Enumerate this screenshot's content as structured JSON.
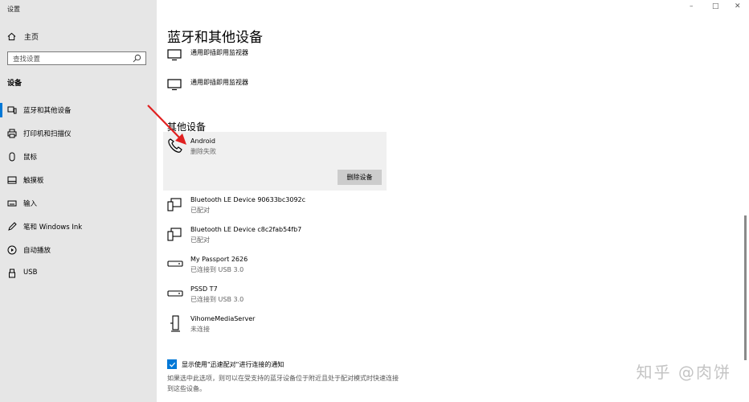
{
  "window": {
    "title": "设置",
    "minimize": "–",
    "maximize": "□",
    "close": "✕"
  },
  "sidebar": {
    "home_label": "主页",
    "search_placeholder": "查找设置",
    "section_title": "设备",
    "items": [
      {
        "label": "蓝牙和其他设备",
        "icon": "bluetooth-devices-icon",
        "active": true
      },
      {
        "label": "打印机和扫描仪",
        "icon": "printer-icon",
        "active": false
      },
      {
        "label": "鼠标",
        "icon": "mouse-icon",
        "active": false
      },
      {
        "label": "触摸板",
        "icon": "touchpad-icon",
        "active": false
      },
      {
        "label": "输入",
        "icon": "keyboard-icon",
        "active": false
      },
      {
        "label": "笔和 Windows Ink",
        "icon": "pen-icon",
        "active": false
      },
      {
        "label": "自动播放",
        "icon": "autoplay-icon",
        "active": false
      },
      {
        "label": "USB",
        "icon": "usb-icon",
        "active": false
      }
    ]
  },
  "main": {
    "title": "蓝牙和其他设备",
    "monitors": [
      {
        "name": "通用即插即用监视器",
        "icon": "monitor-icon"
      },
      {
        "name": "通用即插即用监视器",
        "icon": "monitor-icon"
      }
    ],
    "other_devices_title": "其他设备",
    "selected_device": {
      "name": "Android",
      "status": "删除失败",
      "icon": "phone-icon",
      "remove_label": "删除设备"
    },
    "devices": [
      {
        "name": "Bluetooth LE Device 90633bc3092c",
        "status": "已配对",
        "icon": "bluetooth-device-icon"
      },
      {
        "name": "Bluetooth LE Device c8c2fab54fb7",
        "status": "已配对",
        "icon": "bluetooth-device-icon"
      },
      {
        "name": "My Passport 2626",
        "status": "已连接到 USB 3.0",
        "icon": "drive-icon"
      },
      {
        "name": "PSSD T7",
        "status": "已连接到 USB 3.0",
        "icon": "drive-icon"
      },
      {
        "name": "VihomeMediaServer",
        "status": "未连接",
        "icon": "media-server-icon"
      }
    ],
    "swift_pair": {
      "checked": true,
      "label": "显示使用\"迅速配对\"进行连接的通知",
      "description": "如果选中此选项，则可以在受支持的蓝牙设备位于附近且处于配对模式时快速连接到这些设备。"
    }
  },
  "watermark": "知乎 @肉饼",
  "colors": {
    "accent": "#0078d7",
    "sidebar_bg": "#e6e6e6",
    "selected_bg": "#f0f0f0",
    "annotation_arrow": "#e02020"
  }
}
